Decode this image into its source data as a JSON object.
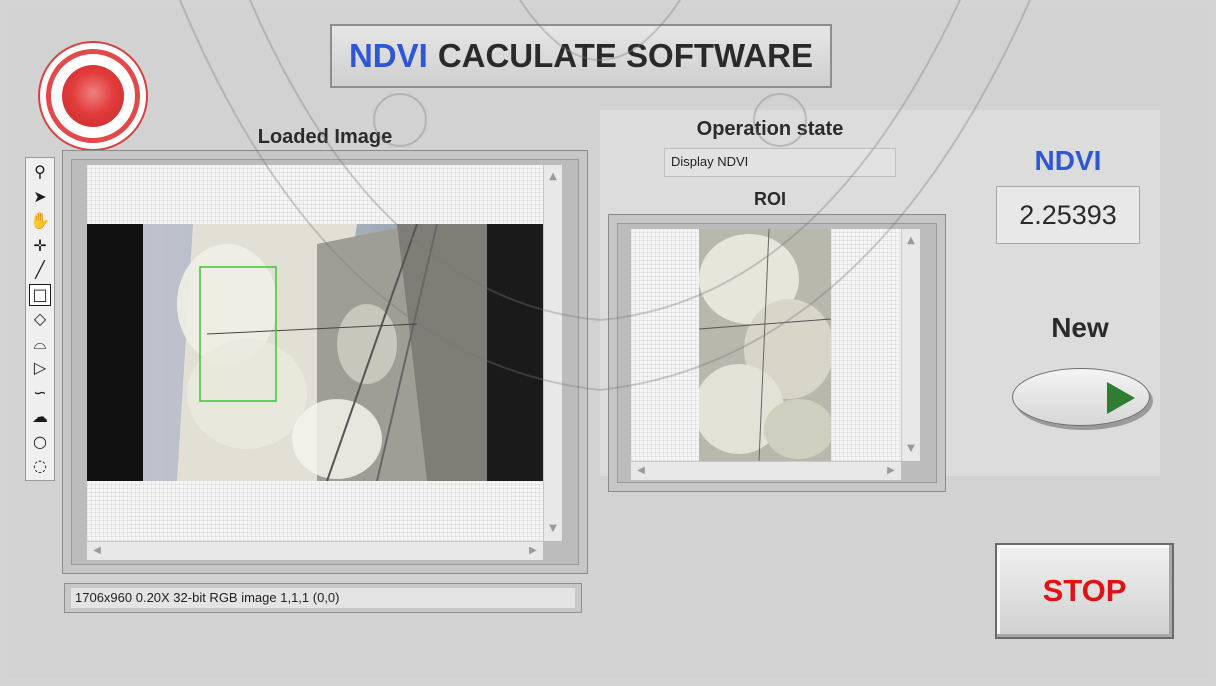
{
  "app": {
    "title_accent": "NDVI",
    "title_rest": "CACULATE SOFTWARE"
  },
  "loaded_image": {
    "label": "Loaded Image",
    "status_text": "1706x960 0.20X 32-bit RGB image 1,1,1    (0,0)"
  },
  "operation_state": {
    "label": "Operation state",
    "value": "Display NDVI"
  },
  "roi": {
    "label": "ROI"
  },
  "ndvi": {
    "label": "NDVI",
    "value": "2.25393"
  },
  "new_button": {
    "label": "New"
  },
  "stop_button": {
    "label": "STOP"
  },
  "tools": [
    {
      "icon": "zoom-icon",
      "glyph": "⚲"
    },
    {
      "icon": "select-arrow-icon",
      "glyph": "➤"
    },
    {
      "icon": "pan-hand-icon",
      "glyph": "✋"
    },
    {
      "icon": "point-icon",
      "glyph": "✛"
    },
    {
      "icon": "line-icon",
      "glyph": "╱"
    },
    {
      "icon": "rectangle-icon",
      "glyph": "□"
    },
    {
      "icon": "rotated-rectangle-icon",
      "glyph": "◇"
    },
    {
      "icon": "annulus-icon",
      "glyph": "⌓"
    },
    {
      "icon": "polygon-icon",
      "glyph": "▷"
    },
    {
      "icon": "freehand-line-icon",
      "glyph": "∽"
    },
    {
      "icon": "freehand-region-icon",
      "glyph": "☁"
    },
    {
      "icon": "oval-icon",
      "glyph": "○"
    },
    {
      "icon": "broken-annulus-icon",
      "glyph": "◌"
    }
  ],
  "colors": {
    "title_accent": "#2f56d4",
    "ndvi_label": "#2f56d4",
    "stop_text": "#e01212",
    "new_led": "#2e7d32",
    "roi_rect": "#3cc43c"
  }
}
